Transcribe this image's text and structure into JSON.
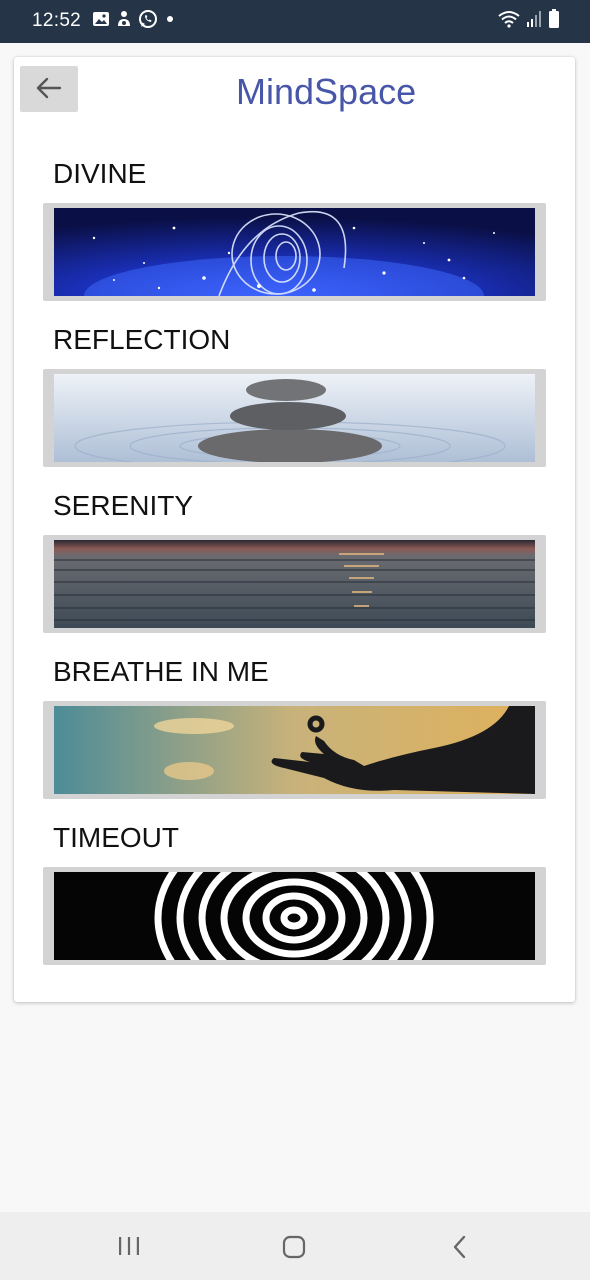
{
  "status_bar": {
    "time": "12:52",
    "left_icons": [
      "gallery-icon",
      "person-icon",
      "whatsapp-icon",
      "dot-icon"
    ],
    "right_icons": [
      "wifi-icon",
      "signal-icon",
      "battery-icon"
    ]
  },
  "header": {
    "title": "MindSpace",
    "back_icon": "arrow-left-icon"
  },
  "sections": [
    {
      "label": "DIVINE",
      "image": "blue-light-swirl-stars"
    },
    {
      "label": "REFLECTION",
      "image": "stacked-stones-water"
    },
    {
      "label": "SERENITY",
      "image": "sea-sunset-horizon"
    },
    {
      "label": "BREATHE IN ME",
      "image": "meditation-hand-silhouette-sky"
    },
    {
      "label": "TIMEOUT",
      "image": "black-white-hypnotic-spiral"
    }
  ],
  "nav_bar": {
    "icons": [
      "recent-apps-icon",
      "home-icon",
      "back-icon"
    ]
  },
  "colors": {
    "status_bar": "#253547",
    "title": "#4756a8",
    "banner_frame": "#d3d3d3",
    "back_button": "#d9d9d9"
  }
}
